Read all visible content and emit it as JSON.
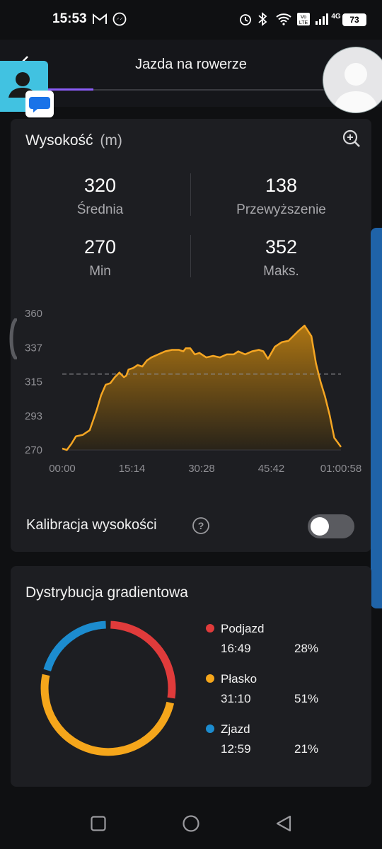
{
  "status_bar": {
    "time": "15:53",
    "battery": "73",
    "network": "4G",
    "volte": "Vo LTE"
  },
  "header": {
    "title": "Jazda na rowerze"
  },
  "altitude": {
    "title": "Wysokość",
    "unit": "(m)",
    "stats": [
      {
        "value": "320",
        "label": "Średnia"
      },
      {
        "value": "138",
        "label": "Przewyższenie"
      },
      {
        "value": "270",
        "label": "Min"
      },
      {
        "value": "352",
        "label": "Maks."
      }
    ],
    "calibration_label": "Kalibracja wysokości",
    "calibration_enabled": false
  },
  "chart_data": {
    "type": "area",
    "title": "",
    "xlabel": "",
    "ylabel": "",
    "x_ticks": [
      "00:00",
      "15:14",
      "30:28",
      "45:42",
      "01:00:58"
    ],
    "y_ticks": [
      "360",
      "337",
      "315",
      "293",
      "270"
    ],
    "ylim": [
      270,
      360
    ],
    "xlim_minutes": [
      0,
      60.97
    ],
    "average_line": 320,
    "series": [
      {
        "color": "#f5a623",
        "x_minutes": [
          0,
          1,
          2,
          3,
          4.5,
          6,
          7.5,
          8.5,
          9.5,
          10.5,
          11.5,
          12.5,
          13.5,
          14,
          14.5,
          15.5,
          16.5,
          17.5,
          18.5,
          19.5,
          21,
          22.5,
          24,
          25.5,
          26.5,
          27,
          28,
          29,
          30,
          31.5,
          33,
          34.5,
          36,
          37.5,
          38.5,
          40,
          41.5,
          43,
          44,
          45,
          46.5,
          48,
          49.5,
          50.5,
          51.5,
          53,
          54.5,
          55.5,
          56.5,
          57.5,
          58.5,
          59.5,
          60.97
        ],
        "values": [
          271,
          270,
          274,
          279,
          280,
          283,
          296,
          306,
          313,
          314,
          318,
          321,
          318,
          319,
          323,
          324,
          326,
          325,
          329,
          331,
          333,
          335,
          336,
          336,
          335,
          337,
          337,
          333,
          334,
          331,
          332,
          331,
          333,
          333,
          335,
          333,
          335,
          336,
          335,
          330,
          338,
          341,
          342,
          345,
          348,
          352,
          345,
          327,
          315,
          305,
          293,
          278,
          272
        ]
      }
    ]
  },
  "gradient": {
    "title": "Dystrybucja gradientowa",
    "items": [
      {
        "name": "Podjazd",
        "time": "16:49",
        "percent": "28%",
        "fraction": 0.28,
        "color": "#e03b3b"
      },
      {
        "name": "Płasko",
        "time": "31:10",
        "percent": "51%",
        "fraction": 0.51,
        "color": "#f5a61b"
      },
      {
        "name": "Zjazd",
        "time": "12:59",
        "percent": "21%",
        "fraction": 0.21,
        "color": "#1c8ccf"
      }
    ]
  },
  "icons": {
    "back": "back-arrow-icon",
    "zoom": "zoom-in-icon",
    "help": "help-circle-icon",
    "contact_bubble": "contact-bubble-icon",
    "avatar": "profile-avatar-icon"
  },
  "colors": {
    "background": "#0f1012",
    "card": "#1d1e22",
    "chart_line": "#f5a623",
    "accent_tab": "#8a5cf6",
    "side_tab": "#1f63a8"
  }
}
